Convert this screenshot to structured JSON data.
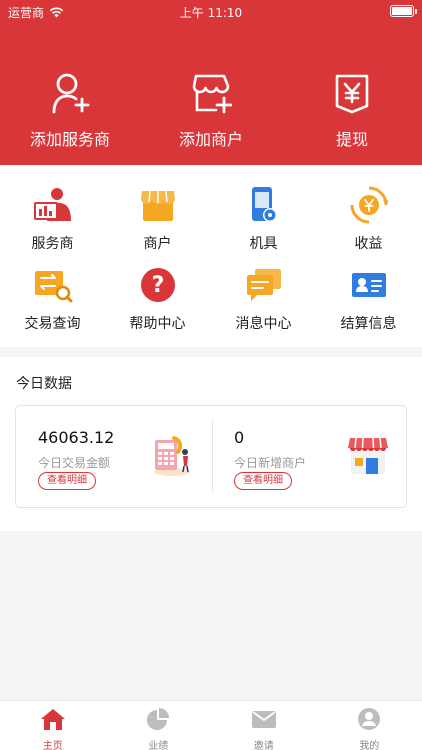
{
  "status_bar": {
    "carrier": "运营商",
    "time": "上午 11:10"
  },
  "actions": [
    {
      "label": "添加服务商",
      "icon": "add-user-icon"
    },
    {
      "label": "添加商户",
      "icon": "add-store-icon"
    },
    {
      "label": "提现",
      "icon": "withdraw-icon"
    }
  ],
  "grid": [
    {
      "label": "服务商",
      "icon": "service-provider-icon"
    },
    {
      "label": "商户",
      "icon": "merchant-icon"
    },
    {
      "label": "机具",
      "icon": "device-icon"
    },
    {
      "label": "收益",
      "icon": "earnings-icon"
    },
    {
      "label": "交易查询",
      "icon": "transaction-query-icon"
    },
    {
      "label": "帮助中心",
      "icon": "help-icon"
    },
    {
      "label": "消息中心",
      "icon": "message-icon"
    },
    {
      "label": "结算信息",
      "icon": "settlement-icon"
    }
  ],
  "today": {
    "title": "今日数据",
    "stats": [
      {
        "value": "46063.12",
        "label": "今日交易金额",
        "button": "查看明细"
      },
      {
        "value": "0",
        "label": "今日新增商户",
        "button": "查看明细"
      }
    ]
  },
  "tabbar": [
    {
      "label": "主页",
      "icon": "home-icon",
      "active": true
    },
    {
      "label": "业绩",
      "icon": "pie-chart-icon",
      "active": false
    },
    {
      "label": "邀请",
      "icon": "mail-icon",
      "active": false
    },
    {
      "label": "我的",
      "icon": "profile-icon",
      "active": false
    }
  ],
  "colors": {
    "brand_red": "#d9363a",
    "orange": "#f5a623",
    "blue": "#2f7de1"
  }
}
